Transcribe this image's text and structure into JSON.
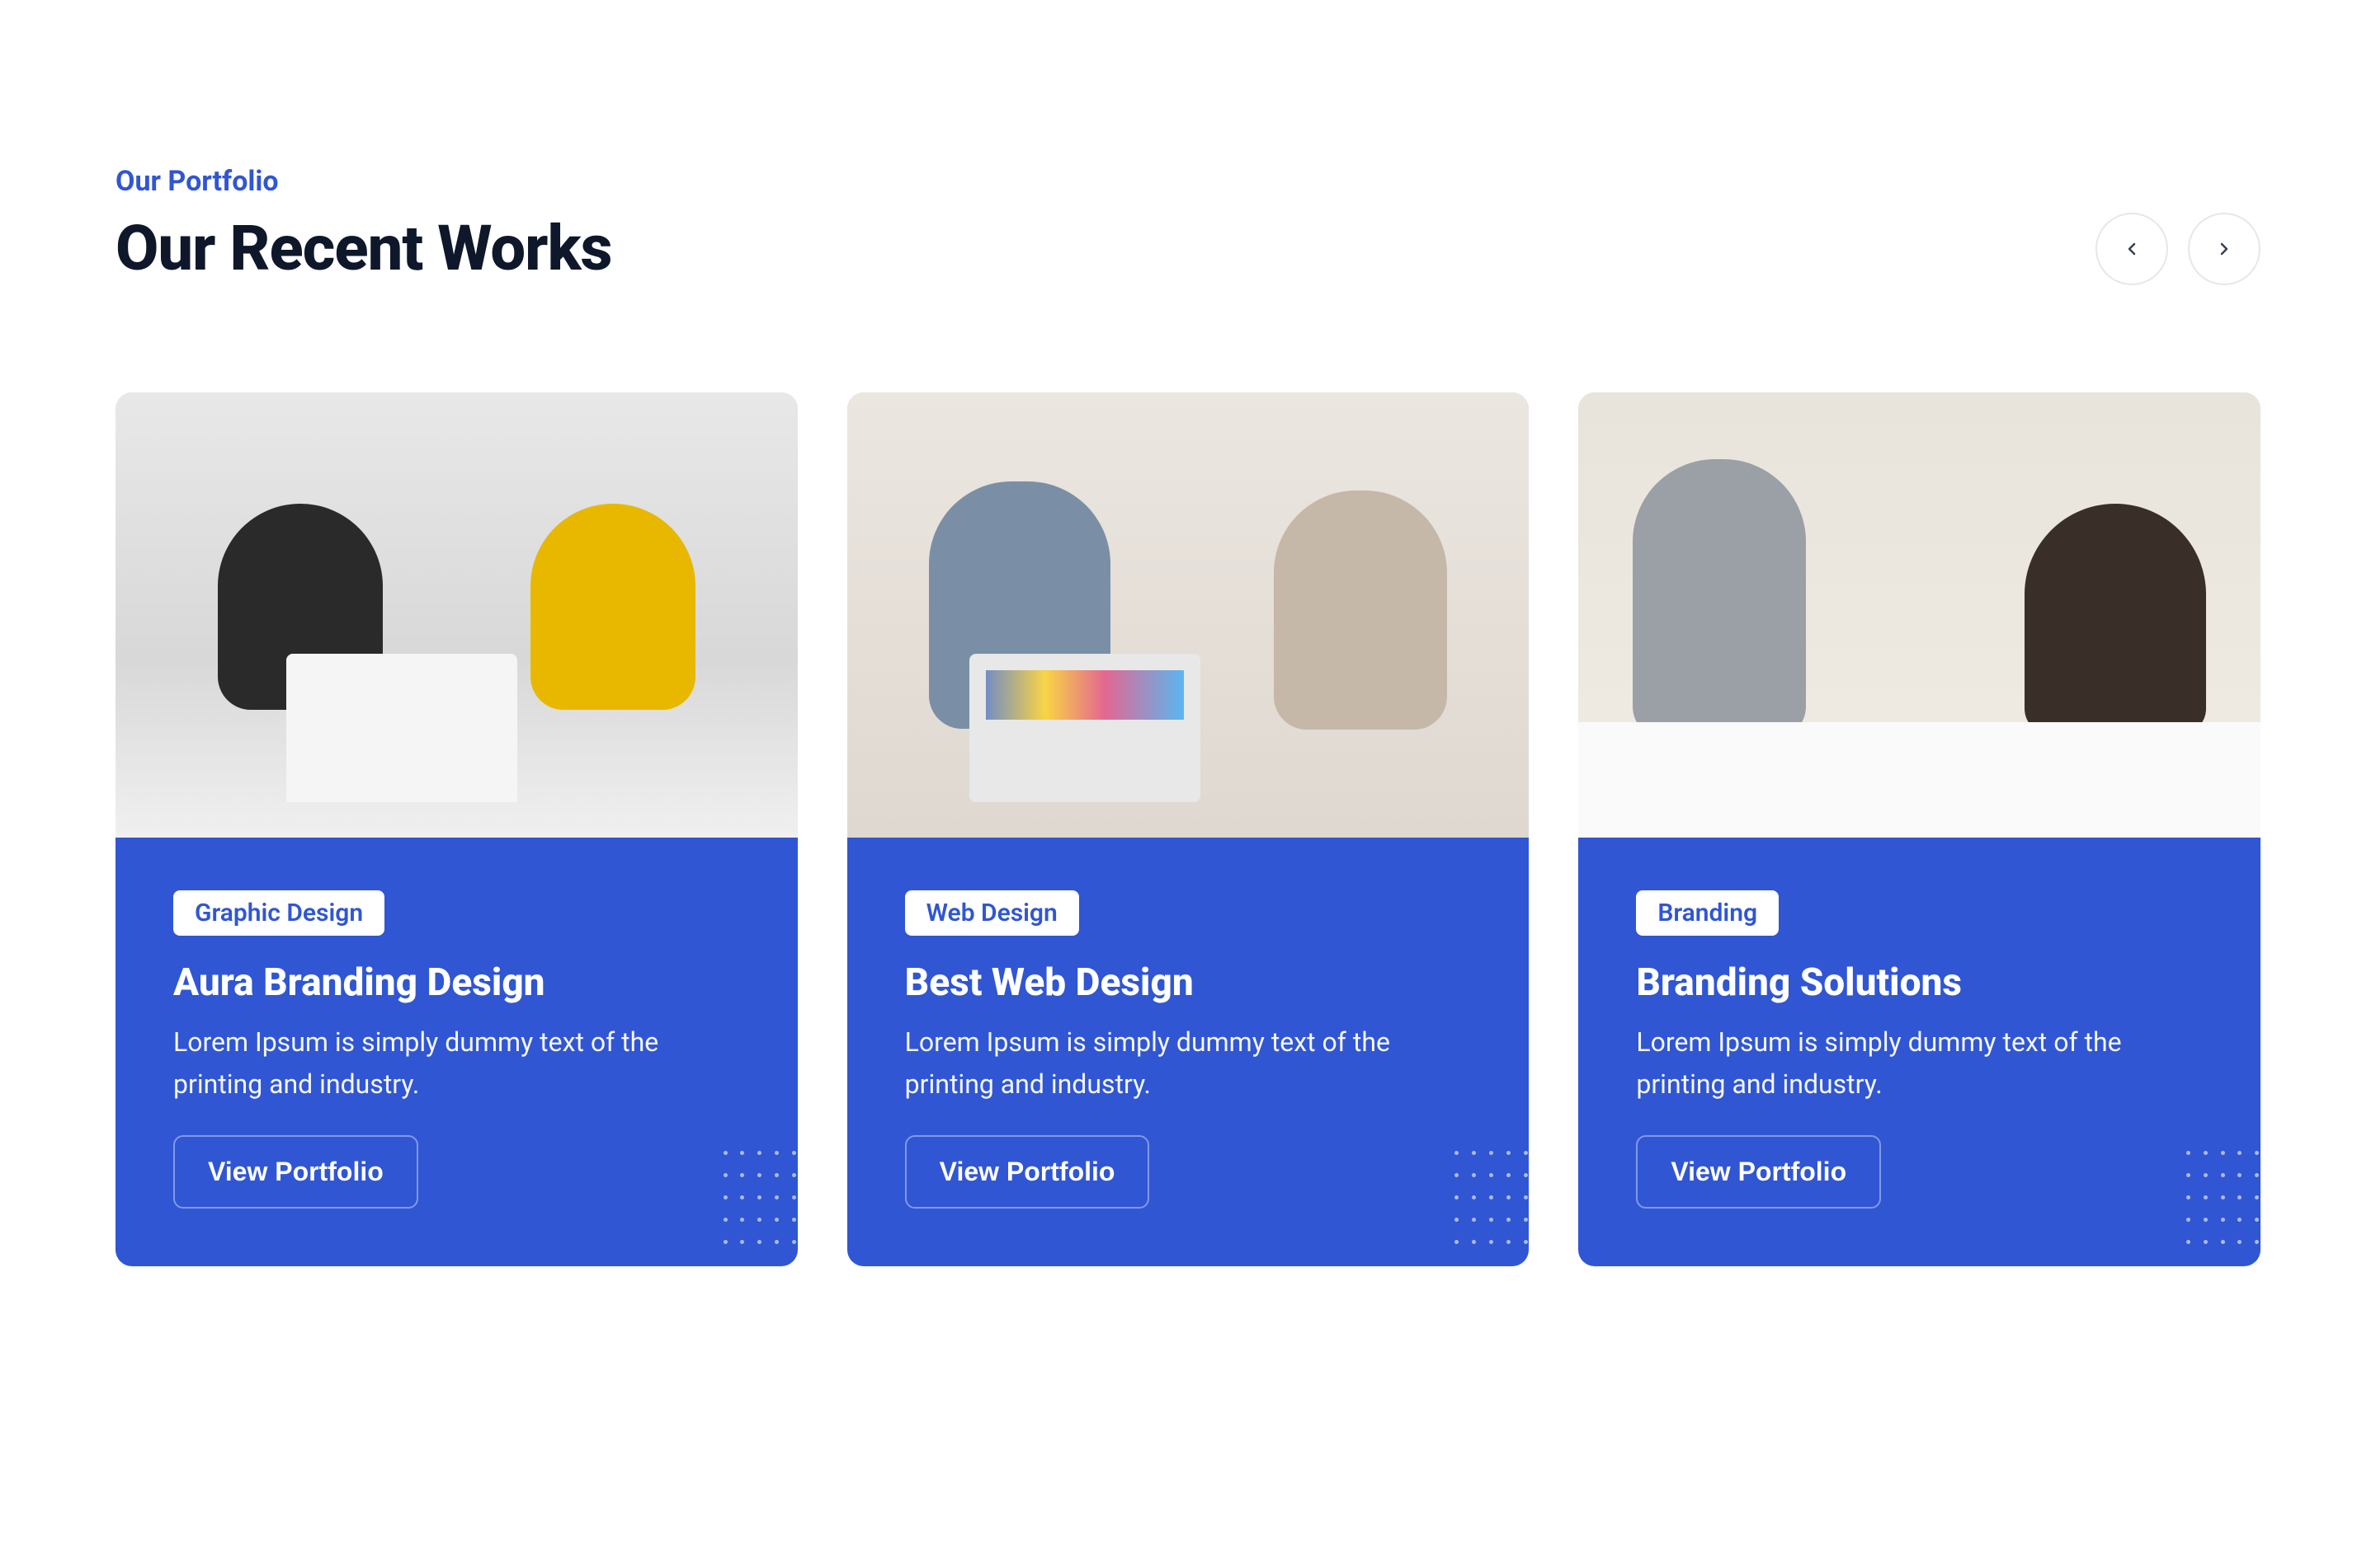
{
  "header": {
    "subtitle": "Our Portfolio",
    "title": "Our Recent Works"
  },
  "colors": {
    "primary": "#3056d3",
    "dark": "#0f172a"
  },
  "cards": [
    {
      "category": "Graphic Design",
      "title": "Aura Branding Design",
      "description": "Lorem Ipsum is simply dummy text of the printing and industry.",
      "button": "View Portfolio"
    },
    {
      "category": "Web Design",
      "title": "Best Web Design",
      "description": "Lorem Ipsum is simply dummy text of the printing and industry.",
      "button": "View Portfolio"
    },
    {
      "category": "Branding",
      "title": "Branding Solutions",
      "description": "Lorem Ipsum is simply dummy text of the printing and industry.",
      "button": "View Portfolio"
    }
  ]
}
